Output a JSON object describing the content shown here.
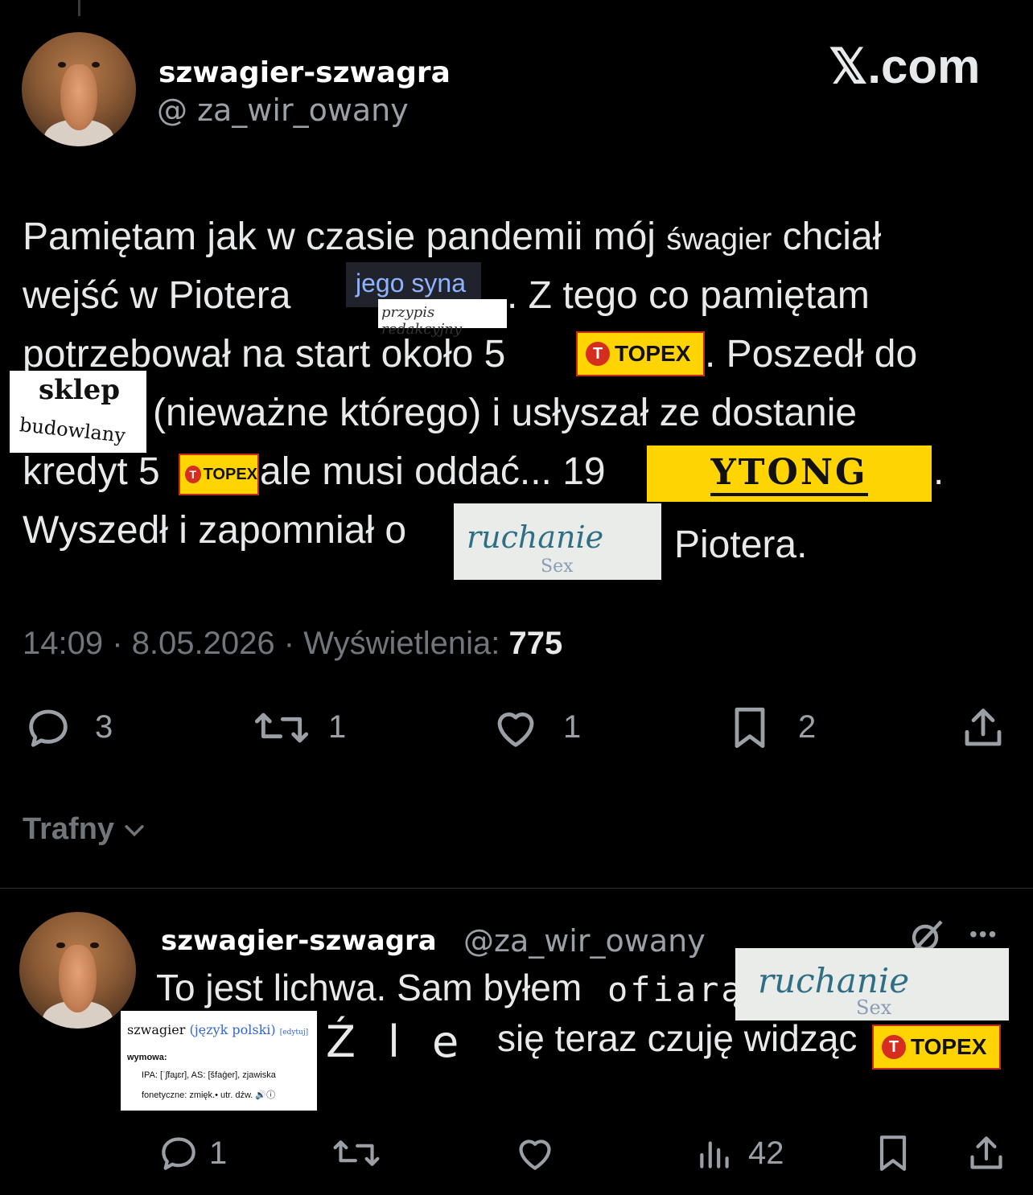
{
  "tweet": {
    "author_name": "szwagier-szwagra",
    "author_handle": "@  za_wir_owany",
    "site_logo": "𝕏.com",
    "lines": [
      "Pamiętam jak w czasie pandemii mój ",
      "śwagier",
      " chciał",
      "wejść w Piotera",
      ". Z tego co pamiętam",
      "potrzebował na start około 5",
      ". Poszedł do",
      "(nieważne którego) i usłyszał ze dostanie",
      "kredyt 5",
      "ale musi oddać... 19",
      ".",
      "Wyszedł i zapomniał o",
      "Piotera."
    ],
    "stickers": {
      "jego_syna": "jego syna",
      "przypis": "przypis redakcyjny",
      "topex": "TOPEX",
      "topex_logo": "T",
      "sklep": "sklep",
      "budowlany": "budowlany",
      "ytong": "YTONG",
      "ruchanie": "ruchanie",
      "sex": "Sex"
    },
    "time": "14:09",
    "date": "8.05.2026",
    "views_label": "Wyświetlenia:",
    "views": "775",
    "sep": "·",
    "actions": {
      "replies": "3",
      "reposts": "1",
      "likes": "1",
      "bookmarks": "2"
    }
  },
  "sort": {
    "label": "Trafny"
  },
  "reply": {
    "author_name": "szwagier-szwagra",
    "author_handle": "@za_wir_owany",
    "more": "•••",
    "line1": "To jest lichwa. Sam byłem ",
    "ofiara": "ofiarą",
    "line2_a": "Źle",
    "line2_b": "się teraz czuję widząc",
    "wiki": {
      "title": "szwagier",
      "lang": "(język polski)",
      "edit": "[edytuj]",
      "wymowa": "wymowa:",
      "ipa": "IPA: [ˈʃfaɟɛr], AS: [šfaģer], zjawiska",
      "fon": "fonetyczne: zmięk.• utr. dźw. 🔊ⓘ"
    },
    "actions": {
      "replies": "1",
      "views": "42"
    }
  },
  "colors": {
    "background": "#000000",
    "text": "#e7e9ea",
    "muted": "#71767b",
    "topex_yellow": "#ffd400",
    "topex_red": "#d52d20"
  }
}
